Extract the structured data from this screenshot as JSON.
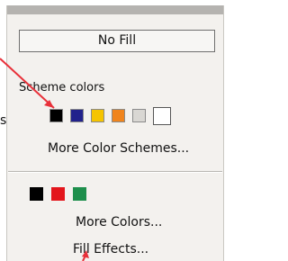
{
  "menu": {
    "no_fill_label": "No Fill",
    "scheme_colors_label": "Scheme colors",
    "scheme_swatches": [
      {
        "name": "black",
        "color": "#000000"
      },
      {
        "name": "blue",
        "color": "#22228c"
      },
      {
        "name": "yellow",
        "color": "#f5c400"
      },
      {
        "name": "orange",
        "color": "#f0841c"
      },
      {
        "name": "light-gray",
        "color": "#d9d7d3"
      },
      {
        "name": "white",
        "color": "#ffffff"
      }
    ],
    "more_color_schemes_label": "More Color Schemes...",
    "recent_swatches": [
      {
        "name": "black",
        "color": "#000000"
      },
      {
        "name": "red",
        "color": "#e3161c"
      },
      {
        "name": "green",
        "color": "#1e8f4c"
      }
    ],
    "more_colors_label": "More Colors...",
    "fill_effects_label": "Fill Effects..."
  },
  "annotation": {
    "arrow_color": "#e8313a",
    "stray_glyph": "s"
  }
}
